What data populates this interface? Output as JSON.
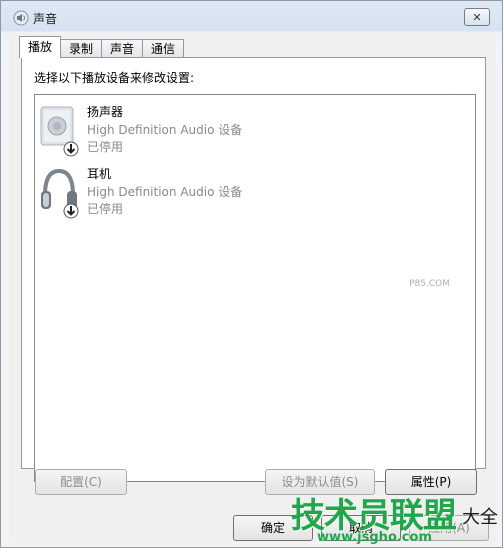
{
  "window": {
    "title": "声音",
    "close_glyph": "✕"
  },
  "tabs": [
    {
      "label": "播放",
      "active": true
    },
    {
      "label": "录制",
      "active": false
    },
    {
      "label": "声音",
      "active": false
    },
    {
      "label": "通信",
      "active": false
    }
  ],
  "panel": {
    "instruction": "选择以下播放设备来修改设置:"
  },
  "devices": [
    {
      "name": "扬声器",
      "description": "High Definition Audio 设备",
      "status": "已停用",
      "icon": "speaker-icon"
    },
    {
      "name": "耳机",
      "description": "High Definition Audio 设备",
      "status": "已停用",
      "icon": "headphones-icon"
    }
  ],
  "buttons": {
    "configure": "配置(C)",
    "set_default": "设为默认值(S)",
    "properties": "属性(P)",
    "ok": "确定",
    "cancel": "取消",
    "apply": "应用(A)"
  },
  "watermark": {
    "text": "技术员联盟",
    "url": "www.jsgho.com",
    "tail": "大全",
    "small": "P85.COM"
  },
  "colors": {
    "accent": "#1fa84a",
    "disabled_text": "#8a8a8a"
  }
}
